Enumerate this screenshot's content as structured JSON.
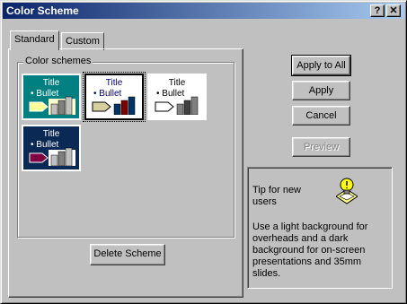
{
  "window": {
    "title": "Color Scheme",
    "help_glyph": "?",
    "close_glyph": "✕"
  },
  "tabs": [
    {
      "label": "Standard"
    },
    {
      "label": "Custom"
    }
  ],
  "color_schemes": {
    "group_label": "Color schemes",
    "swatches": [
      {
        "title": "Title",
        "bullet": "• Bullet",
        "bg": "#008080",
        "text": "#ffffff",
        "accent": "#ffff99",
        "c1": "#ffffcc",
        "c2": "#c0c0c0",
        "c3": "#808080"
      },
      {
        "title": "Title",
        "bullet": "• Bullet",
        "bg": "#ffffff",
        "text": "#000080",
        "accent": "#d4d0a0",
        "c1": "#ffffff",
        "c2": "#003366",
        "c3": "#800000"
      },
      {
        "title": "Title",
        "bullet": "• Bullet",
        "bg": "#ffffff",
        "text": "#000000",
        "accent": "#ffffff",
        "c1": "#ffffff",
        "c2": "#808080",
        "c3": "#404040"
      },
      {
        "title": "Title",
        "bullet": "• Bullet",
        "bg": "#0a2a55",
        "text": "#ffffff",
        "accent": "#800040",
        "c1": "#ffffff",
        "c2": "#c0c0c0",
        "c3": "#808080"
      }
    ],
    "selected_index": 1
  },
  "buttons": {
    "apply_all": "Apply to All",
    "apply": "Apply",
    "cancel": "Cancel",
    "preview": "Preview",
    "delete_scheme": "Delete Scheme"
  },
  "tip": {
    "heading": "Tip for new users",
    "body": "Use a light background for overheads and a dark background for on-screen presentations and 35mm slides.",
    "icon": "lightbulb-icon"
  }
}
